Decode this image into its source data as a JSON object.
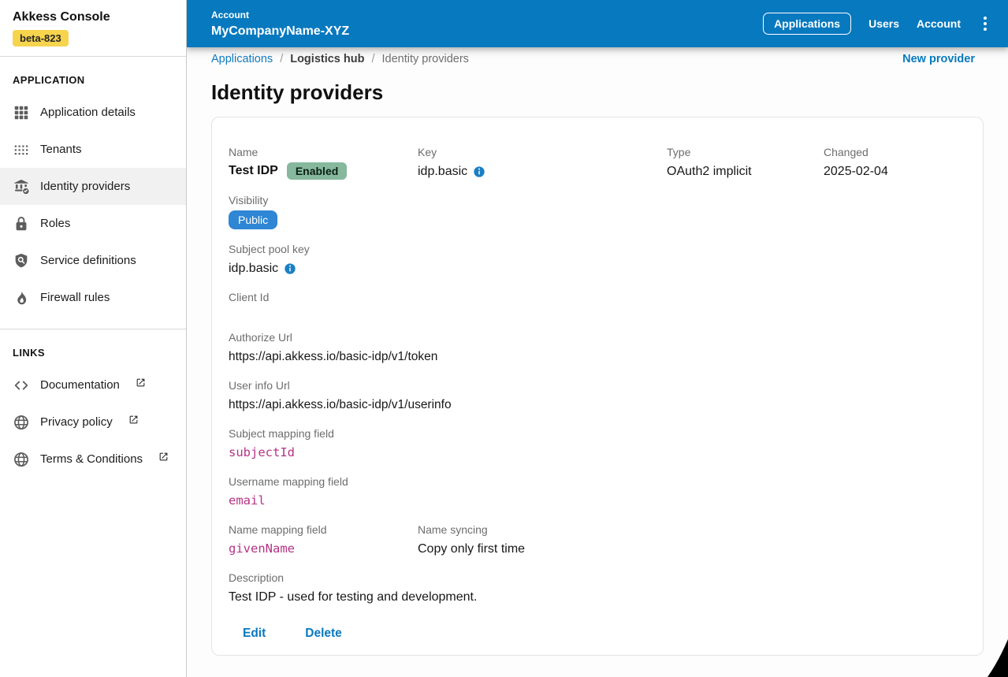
{
  "sidebar": {
    "title": "Akkess Console",
    "env_badge": "beta-823",
    "sections": [
      {
        "header": "APPLICATION",
        "items": [
          {
            "icon": "app-grid-icon",
            "label": "Application details"
          },
          {
            "icon": "tenants-grid-icon",
            "label": "Tenants"
          },
          {
            "icon": "identity-bank-icon",
            "label": "Identity providers",
            "selected": true
          },
          {
            "icon": "lock-icon",
            "label": "Roles"
          },
          {
            "icon": "shield-search-icon",
            "label": "Service definitions"
          },
          {
            "icon": "flame-icon",
            "label": "Firewall rules"
          }
        ]
      },
      {
        "header": "LINKS",
        "items": [
          {
            "icon": "code-icon",
            "label": "Documentation",
            "external": true
          },
          {
            "icon": "globe-icon",
            "label": "Privacy policy",
            "external": true
          },
          {
            "icon": "globe-icon",
            "label": "Terms & Conditions",
            "external": true
          }
        ]
      }
    ]
  },
  "topbar": {
    "account_label": "Account",
    "account_name": "MyCompanyName-XYZ",
    "nav": {
      "applications": "Applications",
      "users": "Users",
      "account": "Account"
    }
  },
  "breadcrumb": {
    "separator": "/",
    "items": [
      "Applications",
      "Logistics hub",
      "Identity providers"
    ],
    "action": "New provider"
  },
  "page": {
    "title": "Identity providers"
  },
  "provider": {
    "name": {
      "label": "Name",
      "value": "Test IDP",
      "status_badge": "Enabled"
    },
    "key": {
      "label": "Key",
      "value": "idp.basic"
    },
    "type": {
      "label": "Type",
      "value": "OAuth2 implicit"
    },
    "changed": {
      "label": "Changed",
      "value": "2025-02-04"
    },
    "visibility": {
      "label": "Visibility",
      "value": "Public"
    },
    "subject_pool_key": {
      "label": "Subject pool key",
      "value": "idp.basic"
    },
    "client_id": {
      "label": "Client Id",
      "value": ""
    },
    "authorize_url": {
      "label": "Authorize Url",
      "value": "https://api.akkess.io/basic-idp/v1/token"
    },
    "user_info_url": {
      "label": "User info Url",
      "value": "https://api.akkess.io/basic-idp/v1/userinfo"
    },
    "subject_mapping": {
      "label": "Subject mapping field",
      "value": "subjectId"
    },
    "username_mapping": {
      "label": "Username mapping field",
      "value": "email"
    },
    "name_mapping": {
      "label": "Name mapping field",
      "value": "givenName"
    },
    "name_syncing": {
      "label": "Name syncing",
      "value": "Copy only first time"
    },
    "description": {
      "label": "Description",
      "value": "Test IDP - used for testing and development."
    }
  },
  "actions": {
    "edit": "Edit",
    "delete": "Delete"
  },
  "colors": {
    "header_blue": "#0779be",
    "link_blue": "#1279be",
    "badge_yellow": "#f6d44d",
    "badge_green": "#85b89d",
    "badge_blue": "#2e86d4",
    "mono_pink": "#b63384"
  }
}
